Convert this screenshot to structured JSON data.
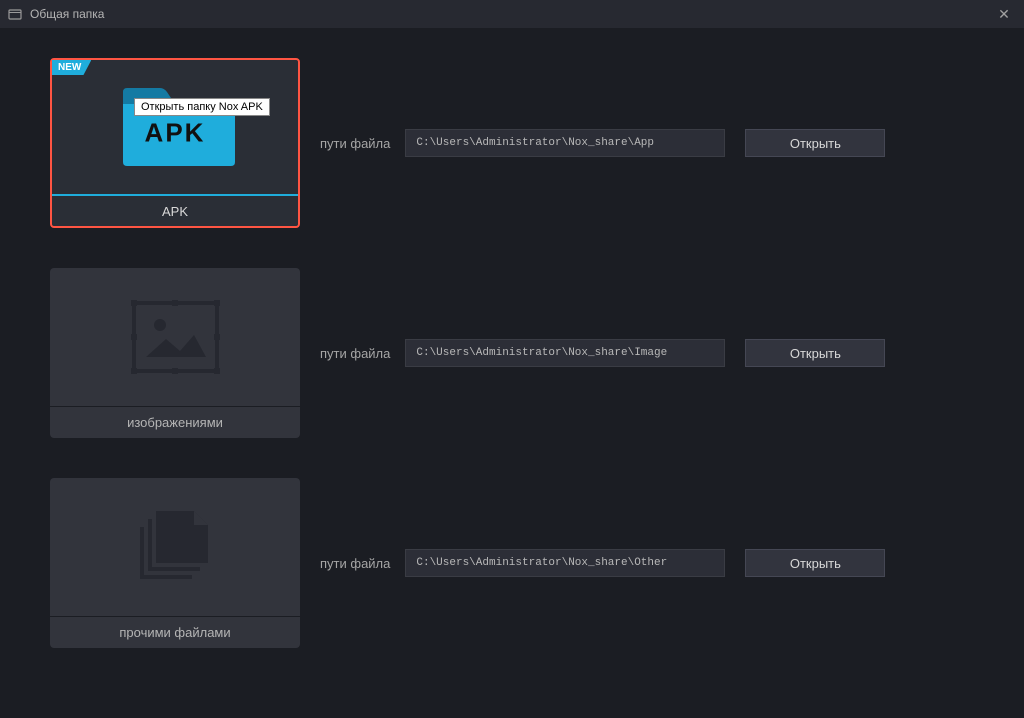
{
  "window": {
    "title": "Общая папка"
  },
  "badge_new": "NEW",
  "tooltip_apk": "Открыть папку Nox APK",
  "rows": [
    {
      "card_label": "APK",
      "folder_text": "APK",
      "path_label": "пути файла",
      "path_value": "C:\\Users\\Administrator\\Nox_share\\App",
      "open_label": "Открыть"
    },
    {
      "card_label": "изображениями",
      "path_label": "пути файла",
      "path_value": "C:\\Users\\Administrator\\Nox_share\\Image",
      "open_label": "Открыть"
    },
    {
      "card_label": "прочими файлами",
      "path_label": "пути файла",
      "path_value": "C:\\Users\\Administrator\\Nox_share\\Other",
      "open_label": "Открыть"
    }
  ]
}
